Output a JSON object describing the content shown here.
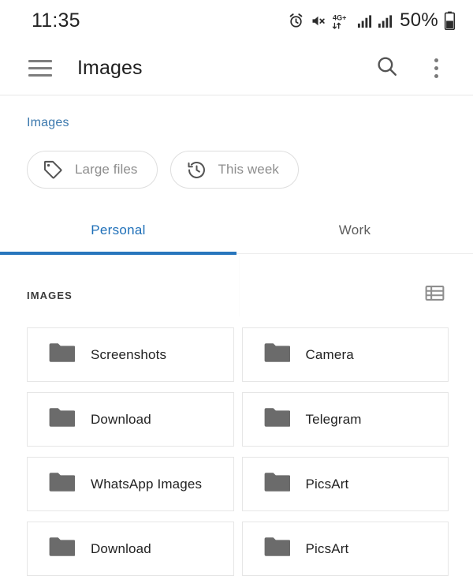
{
  "status_bar": {
    "time": "11:35",
    "battery_percent": "50%",
    "network_label": "4G+",
    "icons": [
      "alarm-icon",
      "mute-icon",
      "network-4g-plus-icon",
      "signal-bars-icon",
      "signal-bars-icon",
      "battery-icon"
    ]
  },
  "app_bar": {
    "title": "Images",
    "menu_icon": "hamburger-icon",
    "search_icon": "search-icon",
    "overflow_icon": "overflow-menu-icon"
  },
  "breadcrumb": {
    "items": [
      "Images"
    ],
    "link_color": "#3b78ad"
  },
  "chips": [
    {
      "label": "Large files",
      "icon": "tag-icon"
    },
    {
      "label": "This week",
      "icon": "history-icon"
    }
  ],
  "tabs": {
    "items": [
      {
        "label": "Personal",
        "active": true
      },
      {
        "label": "Work",
        "active": false
      }
    ],
    "active_color": "#1e6fb8",
    "inactive_color": "#5d5d5d",
    "indicator_color": "#2876bd"
  },
  "section": {
    "title": "IMAGES",
    "view_toggle_icon": "list-view-icon"
  },
  "folders": [
    {
      "name": "Screenshots",
      "icon": "folder-icon"
    },
    {
      "name": "Camera",
      "icon": "folder-icon"
    },
    {
      "name": "Download",
      "icon": "folder-icon"
    },
    {
      "name": "Telegram",
      "icon": "folder-icon"
    },
    {
      "name": "WhatsApp Images",
      "icon": "folder-icon"
    },
    {
      "name": "PicsArt",
      "icon": "folder-icon"
    },
    {
      "name": "Download",
      "icon": "folder-icon"
    },
    {
      "name": "PicsArt",
      "icon": "folder-icon"
    }
  ],
  "colors": {
    "folder_gray": "#6b6b6b",
    "card_border": "#e6e6e6",
    "chip_border": "#dedede"
  }
}
